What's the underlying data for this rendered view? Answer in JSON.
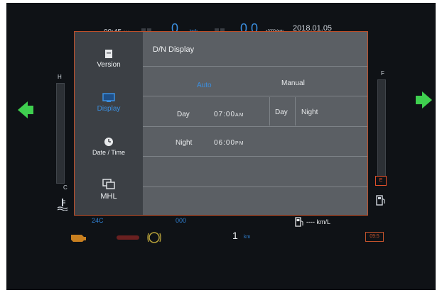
{
  "header": {
    "time": "00:45",
    "time_suffix": "AM",
    "speed": "0",
    "speed_unit": "km/h",
    "rpm": "0.0",
    "rpm_unit": "x1000r/min",
    "date": "2018.01.05"
  },
  "gauges": {
    "temp_high": "H",
    "temp_low": "C",
    "fuel_full": "F",
    "fuel_empty": "E"
  },
  "sidebar": {
    "items": [
      {
        "label": "Version",
        "icon": "version-icon"
      },
      {
        "label": "Display",
        "icon": "display-icon",
        "active": true
      },
      {
        "label": "Date / Time",
        "icon": "clock-icon"
      },
      {
        "label": "MHL",
        "icon": "mhl-icon"
      }
    ]
  },
  "content": {
    "title": "D/N Display",
    "mode_auto": "Auto",
    "mode_manual": "Manual",
    "day_label": "Day",
    "day_time": "07:00",
    "day_ampm": "AM",
    "manual_day": "Day",
    "manual_night": "Night",
    "night_label": "Night",
    "night_time": "06:00",
    "night_ampm": "PM"
  },
  "footer": {
    "temp_value": "24C",
    "odo_value": "000",
    "trip_value": "1",
    "trip_unit": "km",
    "fuel_economy": "---- km/L",
    "box_value": "09:5"
  },
  "colors": {
    "accent_blue": "#3b8fe0",
    "border_orange": "#c2522c",
    "arrow_green": "#3fcf4f"
  }
}
